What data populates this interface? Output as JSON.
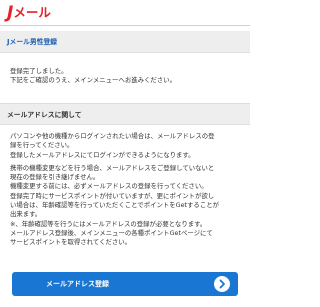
{
  "header": {
    "logo_j": "J",
    "logo_rest": "メール"
  },
  "registration": {
    "title": "Jメール男性登録",
    "line1": "登録完了しました。",
    "line2": "下記をご確認のうえ、メインメニューへお進みください。"
  },
  "email_section": {
    "title": "メールアドレスに関して",
    "para1": [
      "パソコンや他の機種からログインされたい場合は、メールアドレスの登",
      "録を行ってください。",
      "登録したメールアドレスにてログインができるようになります。"
    ],
    "para2": [
      "携帯の機種変更などを行う場合、メールアドレスをご登録していないと",
      "現在の登録を引き継げません。",
      "機種変更する前には、必ずメールアドレスの登録を行ってください。",
      "登録完了時にサービスポイントが付いていますが、更にポイントが欲し",
      "い場合は、年齢確認等を行っていただくことでポイントをGetすることが",
      "出来ます。",
      "※、年齢確認等を行うにはメールアドレスの登録が必要となります。",
      "メールアドレス登録後、メインメニューの各種ポイントGetページにて",
      "サービスポイントを取得されてください。"
    ]
  },
  "cta": {
    "label": "メールアドレス登録"
  },
  "colors": {
    "brand_red": "#e8202a",
    "link_blue": "#1d5fb3",
    "button_blue": "#1976d2"
  }
}
